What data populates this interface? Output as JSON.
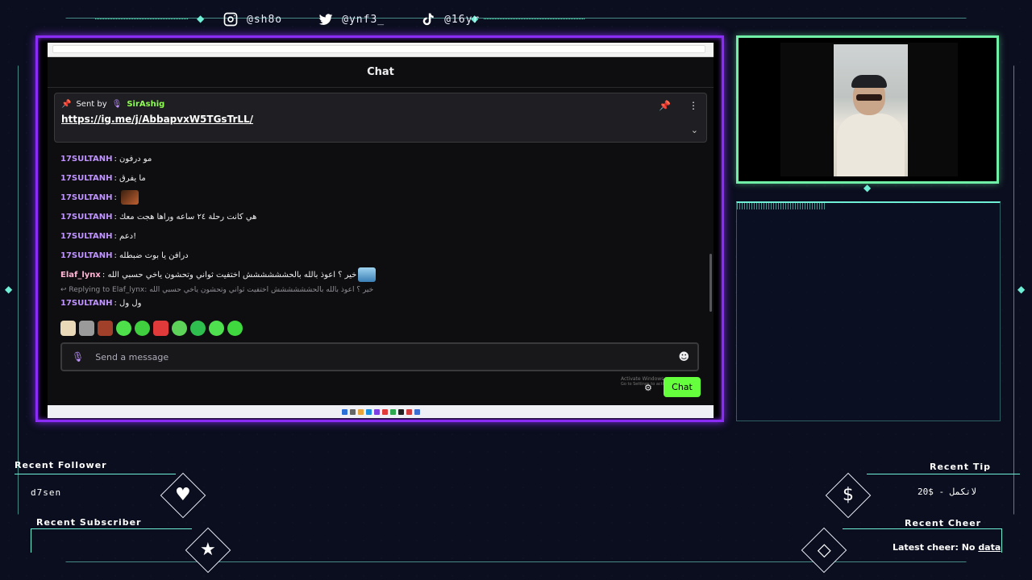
{
  "socials": [
    {
      "icon": "instagram-icon",
      "handle": "@sh8o"
    },
    {
      "icon": "twitter-icon",
      "handle": "@ynf3_"
    },
    {
      "icon": "tiktok-icon",
      "handle": "@16yr"
    }
  ],
  "chat": {
    "title": "Chat",
    "pinned": {
      "sent_by_label": "Sent by",
      "user": "SirAshig",
      "link": "https://ig.me/j/AbbapvxW5TGsTrLL/"
    },
    "messages": [
      {
        "user": "17SULTANH",
        "text": "مو درفون"
      },
      {
        "user": "17SULTANH",
        "text": "ما يفرق"
      },
      {
        "user": "17SULTANH",
        "text": ""
      },
      {
        "user": "17SULTANH",
        "text": "هي كانت رحلة ٢٤ ساعه وراها هجت معك"
      },
      {
        "user": "17SULTANH",
        "text": "دعم!"
      },
      {
        "user": "17SULTANH",
        "text": "درافن يا بوت ضبطله"
      },
      {
        "user": "Elaf_lynx",
        "text": "خير ؟ اعوذ بالله بالحشششششش اختفيت ثواني وتحشون ياخي حسبي الله"
      }
    ],
    "reply": {
      "prefix": "Replying to Elaf_lynx:",
      "text": "خير ؟ اعوذ بالله بالحشششششش اختفيت ثواني وتحشون ياخي حسبي الله"
    },
    "last_message": {
      "user": "17SULTANH",
      "text": "ول ول"
    },
    "input_placeholder": "Send a message",
    "chat_button": "Chat",
    "activate_windows": "Activate Windows",
    "activate_windows_sub": "Go to Settings to activate Windows."
  },
  "widgets": {
    "recent_follower": {
      "label": "Recent Follower",
      "value": "d7sen"
    },
    "recent_subscriber": {
      "label": "Recent Subscriber",
      "value": ""
    },
    "recent_tip": {
      "label": "Recent Tip",
      "value": "20$ - لاتكمل"
    },
    "recent_cheer": {
      "label": "Recent Cheer",
      "prefix": "Latest cheer: No ",
      "suffix": "data"
    }
  },
  "colors": {
    "accent_purple": "#8b2cf5",
    "accent_green": "#6ff0a6",
    "accent_teal": "#6ff0d6",
    "chat_user": "#bf94ff",
    "pin_user": "#8dff4f",
    "chat_button": "#66ff3d"
  }
}
